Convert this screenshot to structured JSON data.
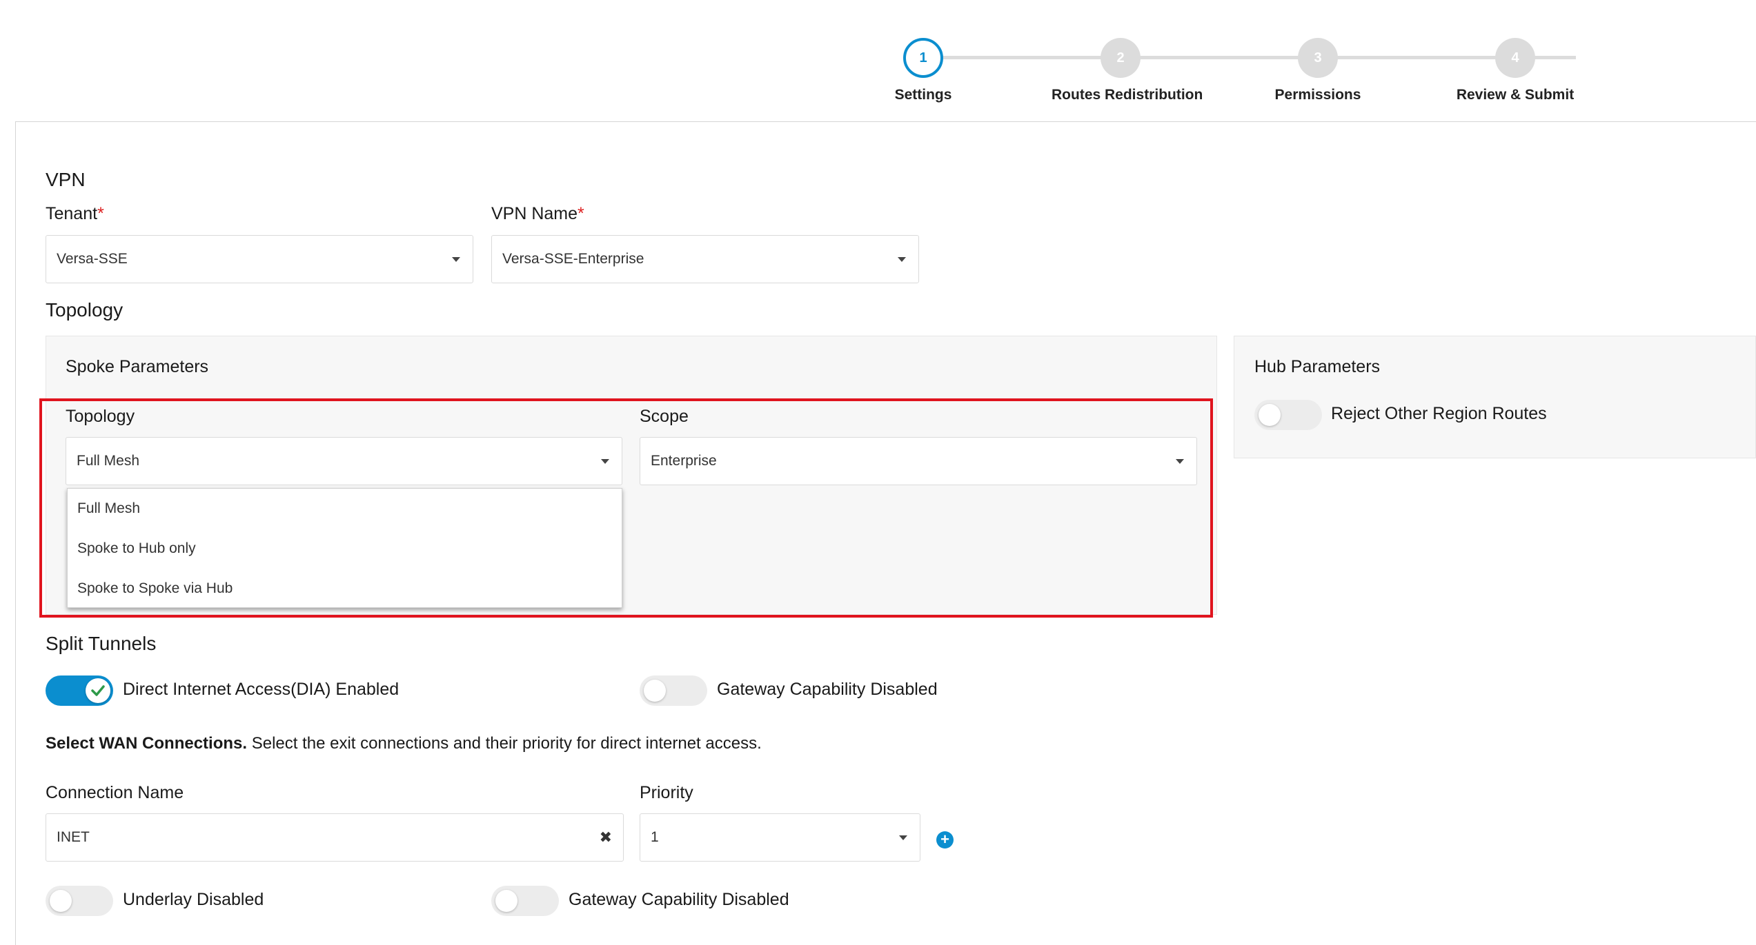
{
  "wizard": {
    "steps": [
      {
        "number": "1",
        "label": "Settings"
      },
      {
        "number": "2",
        "label": "Routes Redistribution"
      },
      {
        "number": "3",
        "label": "Permissions"
      },
      {
        "number": "4",
        "label": "Review & Submit"
      }
    ],
    "active_step": "1"
  },
  "vpn": {
    "section_title": "VPN",
    "tenant_label": "Tenant",
    "tenant_value": "Versa-SSE",
    "vpn_name_label": "VPN Name",
    "vpn_name_value": "Versa-SSE-Enterprise",
    "required_mark": "*"
  },
  "topology": {
    "section_title": "Topology",
    "spoke_parameters": {
      "title": "Spoke Parameters",
      "topology_label": "Topology",
      "topology_value": "Full Mesh",
      "scope_label": "Scope",
      "scope_value": "Enterprise",
      "topology_options": [
        "Full Mesh",
        "Spoke to Hub only",
        "Spoke to Spoke via Hub"
      ]
    },
    "hub_parameters": {
      "title": "Hub Parameters",
      "reject_toggle_label": "Reject Other Region Routes",
      "reject_toggle_on": false
    }
  },
  "split_tunnels": {
    "section_title": "Split Tunnels",
    "dia_label": "Direct Internet Access(DIA) Enabled",
    "dia_on": true,
    "gateway_label": "Gateway Capability Disabled",
    "gateway_on": false,
    "wan_bold": "Select WAN Connections.",
    "wan_desc": " Select the exit connections and their priority for direct internet access.",
    "connection_name_label": "Connection Name",
    "connection_name_value": "INET",
    "priority_label": "Priority",
    "priority_value": "1",
    "underlay_label": "Underlay Disabled",
    "underlay_on": false,
    "gateway2_label": "Gateway Capability Disabled",
    "gateway2_on": false
  },
  "colors": {
    "accent": "#0b8ecf",
    "highlight": "#e0141e",
    "required": "#dd2222"
  },
  "icons": {
    "clear": "close-x-icon",
    "add": "plus-circle-icon",
    "caret": "caret-down-icon",
    "check": "check-icon"
  }
}
